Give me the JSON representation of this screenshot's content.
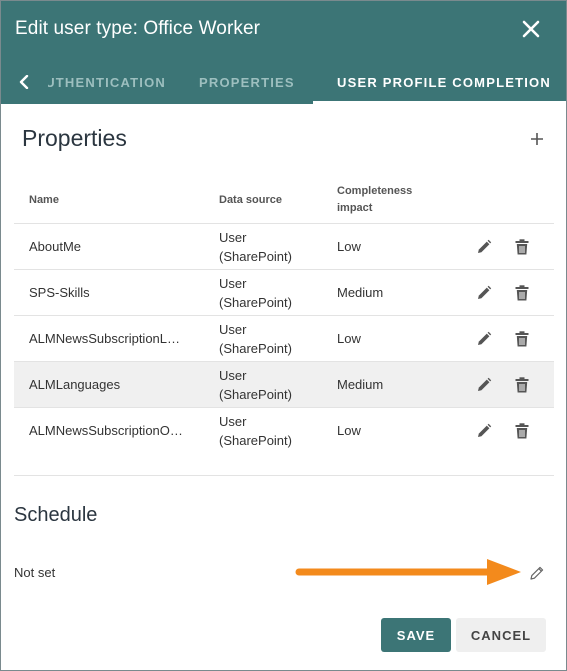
{
  "header": {
    "title": "Edit user type: Office Worker",
    "tabs": [
      {
        "label": "AUTHENTICATION",
        "active": false
      },
      {
        "label": "PROPERTIES",
        "active": false
      },
      {
        "label": "USER PROFILE COMPLETION",
        "active": true
      }
    ]
  },
  "properties": {
    "title": "Properties",
    "columns": {
      "name": "Name",
      "source": "Data source",
      "impact": "Completeness impact"
    },
    "rows": [
      {
        "name": "AboutMe",
        "source": "User (SharePoint)",
        "impact": "Low",
        "highlighted": false
      },
      {
        "name": "SPS-Skills",
        "source": "User (SharePoint)",
        "impact": "Medium",
        "highlighted": false
      },
      {
        "name": "ALMNewsSubscriptionL…",
        "source": "User (SharePoint)",
        "impact": "Low",
        "highlighted": false
      },
      {
        "name": "ALMLanguages",
        "source": "User (SharePoint)",
        "impact": "Medium",
        "highlighted": true
      },
      {
        "name": "ALMNewsSubscriptionO…",
        "source": "User (SharePoint)",
        "impact": "Low",
        "highlighted": false
      }
    ]
  },
  "schedule": {
    "title": "Schedule",
    "value": "Not set"
  },
  "footer": {
    "save_label": "SAVE",
    "cancel_label": "CANCEL"
  },
  "icons": {
    "close": "close-icon",
    "back": "chevron-left-icon",
    "add": "plus-icon",
    "edit": "pencil-icon",
    "delete": "trash-icon"
  },
  "colors": {
    "header": "#3c7576",
    "accent_arrow": "#f38a1c",
    "save_button": "#3c7576"
  }
}
